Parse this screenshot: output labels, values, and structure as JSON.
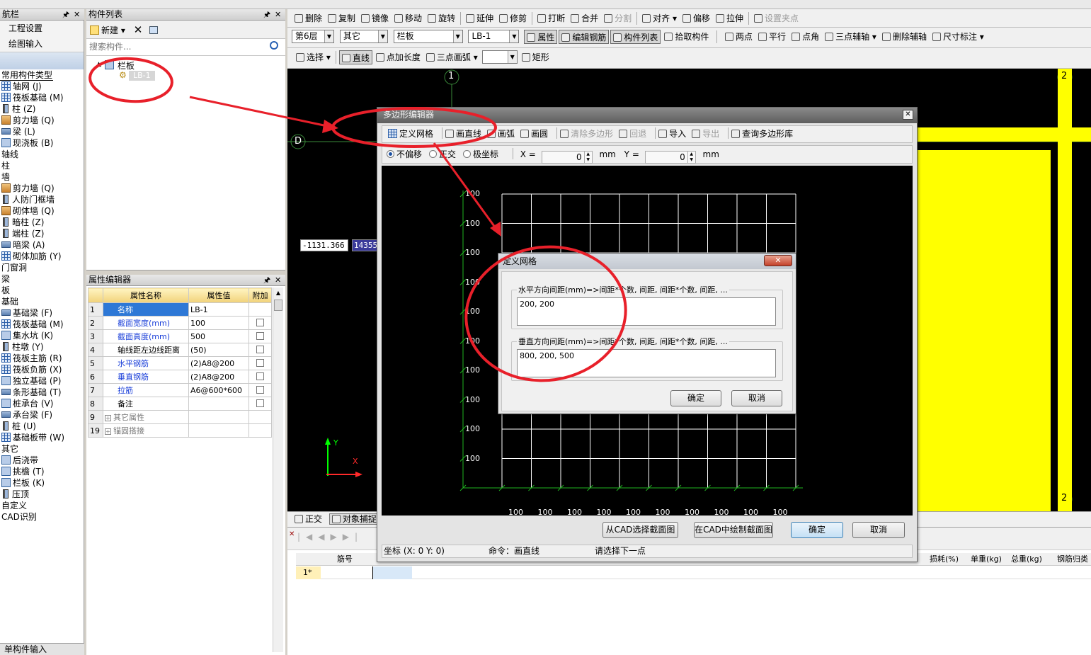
{
  "top_toolbar": {
    "r1": [
      "删除",
      "复制",
      "镜像",
      "移动",
      "旋转",
      "延伸",
      "修剪",
      "打断",
      "合并",
      "分割",
      "对齐",
      "偏移",
      "拉伸",
      "设置夹点"
    ],
    "floor": "第6层",
    "category": "其它",
    "component_type": "栏板",
    "component": "LB-1",
    "r2": [
      "属性",
      "编辑钢筋",
      "构件列表",
      "拾取构件"
    ],
    "r2b": [
      "两点",
      "平行",
      "点角",
      "三点辅轴",
      "删除辅轴",
      "尺寸标注"
    ],
    "r3": [
      "选择",
      "直线",
      "点加长度",
      "三点画弧",
      "矩形"
    ]
  },
  "nav": {
    "title": "航栏",
    "items": [
      "工程设置",
      "绘图输入"
    ],
    "tree_label": "常用构件类型",
    "tree": [
      {
        "t": "轴网 (J)",
        "i": "grid",
        "s": 1
      },
      {
        "t": "筏板基础 (M)",
        "i": "grid",
        "s": 1
      },
      {
        "t": "柱 (Z)",
        "i": "post",
        "s": 1
      },
      {
        "t": "剪力墙 (Q)",
        "i": "wall",
        "s": 1
      },
      {
        "t": "梁 (L)",
        "i": "beam",
        "s": 1
      },
      {
        "t": "现浇板 (B)",
        "i": "box",
        "s": 1
      },
      {
        "t": "轴线",
        "s": 0
      },
      {
        "t": "柱",
        "s": 0
      },
      {
        "t": "墙",
        "s": 0
      },
      {
        "t": "剪力墙 (Q)",
        "i": "wall",
        "s": 1
      },
      {
        "t": "人防门框墙",
        "i": "post",
        "s": 1
      },
      {
        "t": "砌体墙 (Q)",
        "i": "wall",
        "s": 1
      },
      {
        "t": "暗柱 (Z)",
        "i": "post",
        "s": 1
      },
      {
        "t": "端柱 (Z)",
        "i": "post",
        "s": 1
      },
      {
        "t": "暗梁 (A)",
        "i": "beam",
        "s": 1
      },
      {
        "t": "砌体加筋 (Y)",
        "i": "grid",
        "s": 1
      },
      {
        "t": "门窗洞",
        "s": 0
      },
      {
        "t": "梁",
        "s": 0
      },
      {
        "t": "板",
        "s": 0
      },
      {
        "t": "基础",
        "s": 0
      },
      {
        "t": "基础梁 (F)",
        "i": "beam",
        "s": 1
      },
      {
        "t": "筏板基础 (M)",
        "i": "grid",
        "s": 1
      },
      {
        "t": "集水坑 (K)",
        "i": "box",
        "s": 1
      },
      {
        "t": "柱墩 (Y)",
        "i": "post",
        "s": 1
      },
      {
        "t": "筏板主筋 (R)",
        "i": "grid",
        "s": 1
      },
      {
        "t": "筏板负筋 (X)",
        "i": "grid",
        "s": 1
      },
      {
        "t": "独立基础 (P)",
        "i": "box",
        "s": 1
      },
      {
        "t": "条形基础 (T)",
        "i": "beam",
        "s": 1
      },
      {
        "t": "桩承台 (V)",
        "i": "box",
        "s": 1
      },
      {
        "t": "承台梁 (F)",
        "i": "beam",
        "s": 1
      },
      {
        "t": "桩 (U)",
        "i": "post",
        "s": 1
      },
      {
        "t": "基础板带 (W)",
        "i": "grid",
        "s": 1
      },
      {
        "t": "其它",
        "s": 0
      },
      {
        "t": "后浇带",
        "i": "box",
        "s": 1
      },
      {
        "t": "挑檐 (T)",
        "i": "box",
        "s": 1
      },
      {
        "t": "栏板 (K)",
        "i": "box",
        "s": 1
      },
      {
        "t": "压顶",
        "i": "post",
        "s": 1
      },
      {
        "t": "自定义",
        "s": 0
      },
      {
        "t": "CAD识别",
        "s": 0
      }
    ],
    "bottom": "单构件输入"
  },
  "complist": {
    "title": "构件列表",
    "new_btn": "新建",
    "search_ph": "搜索构件...",
    "root": "栏板",
    "child": "LB-1"
  },
  "props": {
    "title": "属性编辑器",
    "headers": [
      "属性名称",
      "属性值",
      "附加"
    ],
    "rows": [
      {
        "n": "1",
        "k": "名称",
        "v": "LB-1",
        "blue": true,
        "chk": false
      },
      {
        "n": "2",
        "k": "截面宽度(mm)",
        "v": "100",
        "blue": true,
        "chk": true
      },
      {
        "n": "3",
        "k": "截面高度(mm)",
        "v": "500",
        "blue": true,
        "chk": true
      },
      {
        "n": "4",
        "k": "轴线距左边线距离",
        "v": "(50)",
        "blue": false,
        "chk": true
      },
      {
        "n": "5",
        "k": "水平钢筋",
        "v": "(2)A8@200",
        "blue": true,
        "chk": true
      },
      {
        "n": "6",
        "k": "垂直钢筋",
        "v": "(2)A8@200",
        "blue": true,
        "chk": true
      },
      {
        "n": "7",
        "k": "拉筋",
        "v": "A6@600*600",
        "blue": true,
        "chk": true
      },
      {
        "n": "8",
        "k": "备注",
        "v": "",
        "blue": false,
        "chk": true
      },
      {
        "n": "9",
        "k": "其它属性",
        "v": "",
        "blue": false,
        "chk": false,
        "exp": true
      },
      {
        "n": "19",
        "k": "锚固搭接",
        "v": "",
        "blue": false,
        "chk": false,
        "exp": true
      }
    ]
  },
  "canvas": {
    "axis_1": "1",
    "axis_2": "2",
    "axis_d": "D",
    "coord_x": "-1131.366",
    "coord_y": "14355",
    "axis_y_label": "Y",
    "axis_x_label": "X"
  },
  "bottom_bar": {
    "b1": "正交",
    "b2": "对象捕捉",
    "table_headers": [
      "筋号",
      "",
      "损耗(%)",
      "单重(kg)",
      "总重(kg)",
      "钢筋归类"
    ],
    "row1": "1*"
  },
  "poly_dlg": {
    "title": "多边形编辑器",
    "tools": [
      "定义网格",
      "画直线",
      "画弧",
      "画圆",
      "清除多边形",
      "回退",
      "导入",
      "导出",
      "查询多边形库"
    ],
    "radios": [
      "不偏移",
      "正交",
      "极坐标"
    ],
    "x_label": "X =",
    "x_val": "0",
    "y_label": "Y =",
    "y_val": "0",
    "unit": "mm",
    "grid_labels_left": [
      "100",
      "100",
      "100",
      "100",
      "100",
      "100",
      "100",
      "100",
      "100",
      "100"
    ],
    "grid_labels_bottom": [
      "100",
      "100",
      "100",
      "100",
      "100",
      "100",
      "100",
      "100",
      "100",
      "100"
    ],
    "btn_cad_select": "从CAD选择截面图",
    "btn_cad_draw": "在CAD中绘制截面图",
    "btn_ok": "确定",
    "btn_cancel": "取消",
    "status_coord": "坐标 (X: 0 Y: 0)",
    "status_cmd": "命令：画直线",
    "status_prompt": "请选择下一点"
  },
  "grid_dlg": {
    "title": "定义网格",
    "h_label": "水平方向间距(mm)=>间距*个数, 间距, 间距*个数, 间距, ...",
    "h_val": "200, 200",
    "v_label": "垂直方向间距(mm)=>间距*个数, 间距, 间距*个数, 间距, ...",
    "v_val": "800, 200, 500",
    "ok": "确定",
    "cancel": "取消"
  }
}
